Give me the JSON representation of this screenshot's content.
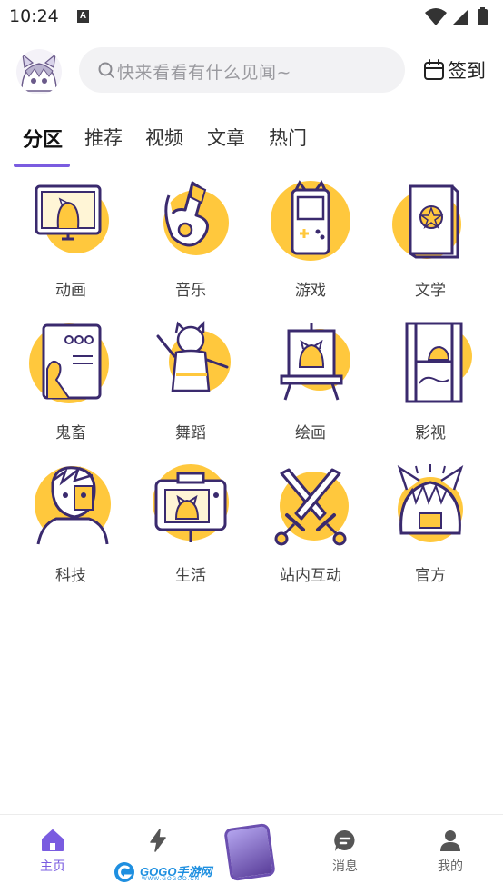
{
  "status_bar": {
    "time": "10:24",
    "notification_letter": "A"
  },
  "header": {
    "search_placeholder": "快来看看有什么见闻~",
    "checkin_label": "签到"
  },
  "tabs": [
    {
      "label": "分区",
      "active": true
    },
    {
      "label": "推荐",
      "active": false
    },
    {
      "label": "视频",
      "active": false
    },
    {
      "label": "文章",
      "active": false
    },
    {
      "label": "热门",
      "active": false
    }
  ],
  "categories": [
    {
      "label": "动画",
      "icon": "monitor-icon"
    },
    {
      "label": "音乐",
      "icon": "guitar-icon"
    },
    {
      "label": "游戏",
      "icon": "gameboy-icon"
    },
    {
      "label": "文学",
      "icon": "book-icon"
    },
    {
      "label": "鬼畜",
      "icon": "poster-icon"
    },
    {
      "label": "舞蹈",
      "icon": "dancer-icon"
    },
    {
      "label": "绘画",
      "icon": "easel-icon"
    },
    {
      "label": "影视",
      "icon": "film-icon"
    },
    {
      "label": "科技",
      "icon": "cyborg-icon"
    },
    {
      "label": "生活",
      "icon": "camera-icon"
    },
    {
      "label": "站内互动",
      "icon": "swords-icon"
    },
    {
      "label": "官方",
      "icon": "mascot-icon"
    }
  ],
  "bottom_nav": [
    {
      "label": "主页",
      "icon": "home-icon",
      "active": true
    },
    {
      "label": "",
      "icon": "lightning-icon",
      "active": false
    },
    {
      "label": "",
      "icon": "center-thumbnail",
      "active": false
    },
    {
      "label": "消息",
      "icon": "message-icon",
      "active": false
    },
    {
      "label": "我的",
      "icon": "profile-icon",
      "active": false
    }
  ],
  "watermark": {
    "text": "GOGO手游网",
    "sub": "WWW.GOGOO.CN"
  },
  "colors": {
    "accent": "#7a5ce0",
    "icon_yellow": "#ffc83d",
    "icon_stroke": "#3a2a6e"
  }
}
